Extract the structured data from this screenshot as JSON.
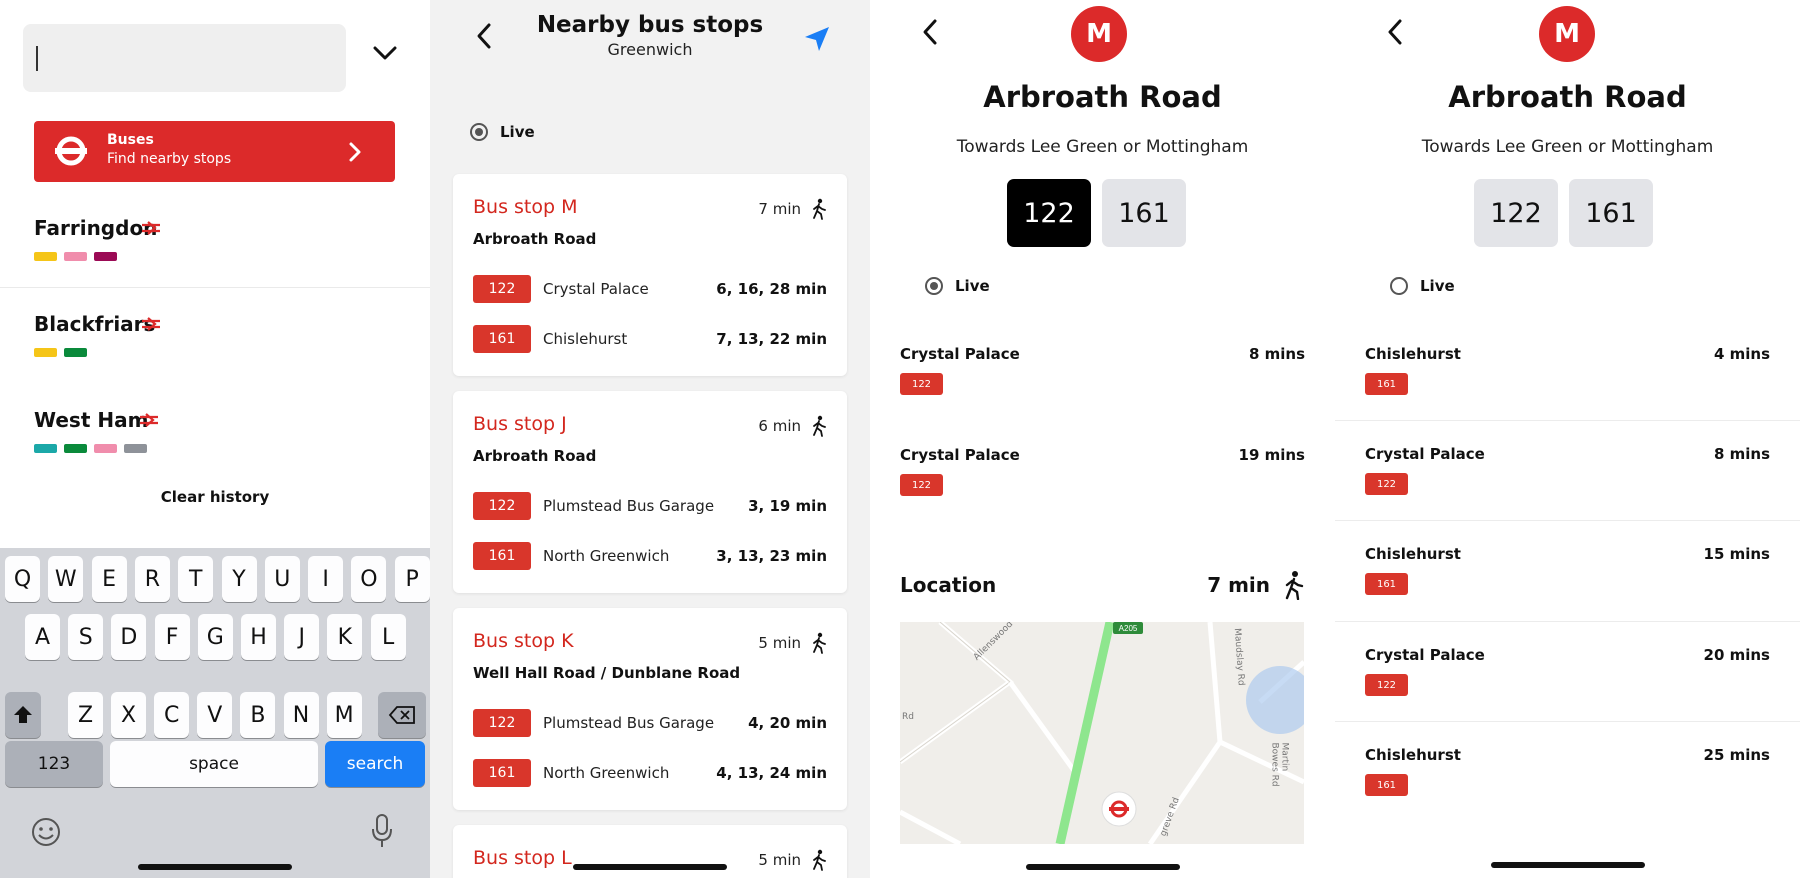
{
  "panel1": {
    "search": {
      "value": ""
    },
    "buses_card": {
      "title": "Buses",
      "subtitle": "Find nearby stops"
    },
    "stations": [
      {
        "name": "Farringdon",
        "lines": [
          "#f5c518",
          "#f08dac",
          "#9b0a55"
        ]
      },
      {
        "name": "Blackfriars",
        "lines": [
          "#f5c518",
          "#0a8a3b"
        ]
      },
      {
        "name": "West Ham",
        "lines": [
          "#1ba8a8",
          "#0a8a3b",
          "#f08dac",
          "#8e9299"
        ]
      }
    ],
    "clear_history": "Clear history",
    "keyboard": {
      "row1": [
        "Q",
        "W",
        "E",
        "R",
        "T",
        "Y",
        "U",
        "I",
        "O",
        "P"
      ],
      "row2": [
        "A",
        "S",
        "D",
        "F",
        "G",
        "H",
        "J",
        "K",
        "L"
      ],
      "row3": [
        "Z",
        "X",
        "C",
        "V",
        "B",
        "N",
        "M"
      ],
      "numbers_key": "123",
      "space_key": "space",
      "search_key": "search"
    }
  },
  "panel2": {
    "title": "Nearby bus stops",
    "subtitle": "Greenwich",
    "live_label": "Live",
    "stops": [
      {
        "title": "Bus stop M",
        "walk": "7 min",
        "road": "Arbroath Road",
        "routes": [
          {
            "num": "122",
            "dest": "Crystal Palace",
            "times": "6, 16, 28 min"
          },
          {
            "num": "161",
            "dest": "Chislehurst",
            "times": "7, 13, 22 min"
          }
        ]
      },
      {
        "title": "Bus stop J",
        "walk": "6 min",
        "road": "Arbroath Road",
        "routes": [
          {
            "num": "122",
            "dest": "Plumstead Bus Garage",
            "times": "3, 19 min"
          },
          {
            "num": "161",
            "dest": "North Greenwich",
            "times": "3, 13, 23 min"
          }
        ]
      },
      {
        "title": "Bus stop K",
        "walk": "5 min",
        "road": "Well Hall Road / Dunblane Road",
        "routes": [
          {
            "num": "122",
            "dest": "Plumstead Bus Garage",
            "times": "4, 20 min"
          },
          {
            "num": "161",
            "dest": "North Greenwich",
            "times": "4, 13, 24 min"
          }
        ]
      },
      {
        "title": "Bus stop L",
        "walk": "5 min"
      }
    ]
  },
  "panel3": {
    "stop_letter": "M",
    "stop_name": "Arbroath Road",
    "towards": "Towards Lee Green or Mottingham",
    "route_tabs": [
      "122",
      "161"
    ],
    "live_label": "Live",
    "arrivals": [
      {
        "dest": "Crystal Palace",
        "mins": "8 mins",
        "route": "122"
      },
      {
        "dest": "Crystal Palace",
        "mins": "19 mins",
        "route": "122"
      }
    ],
    "location_label": "Location",
    "location_time": "7 min",
    "map": {
      "road_sign": "A205",
      "streets": [
        "Allenswood",
        "Maudslay Rd",
        "Rd",
        "Martin Bowes Rd",
        "greve Rd"
      ]
    }
  },
  "panel4": {
    "stop_letter": "M",
    "stop_name": "Arbroath Road",
    "towards": "Towards Lee Green or Mottingham",
    "route_tabs": [
      "122",
      "161"
    ],
    "live_label": "Live",
    "arrivals": [
      {
        "dest": "Chislehurst",
        "mins": "4 mins",
        "route": "161"
      },
      {
        "dest": "Crystal Palace",
        "mins": "8 mins",
        "route": "122"
      },
      {
        "dest": "Chislehurst",
        "mins": "15 mins",
        "route": "161"
      },
      {
        "dest": "Crystal Palace",
        "mins": "20 mins",
        "route": "122"
      },
      {
        "dest": "Chislehurst",
        "mins": "25 mins",
        "route": "161"
      }
    ]
  },
  "colors": {
    "tfl_red": "#dc2a2a",
    "ios_blue": "#1a7ef5",
    "route_badge": "#d9362b"
  },
  "icons": [
    "chevron-down-icon",
    "tfl-roundel-icon",
    "chevron-right-icon",
    "national-rail-icon",
    "back-chevron-icon",
    "location-arrow-icon",
    "walk-icon",
    "shift-icon",
    "backspace-icon",
    "emoji-icon",
    "microphone-icon"
  ]
}
